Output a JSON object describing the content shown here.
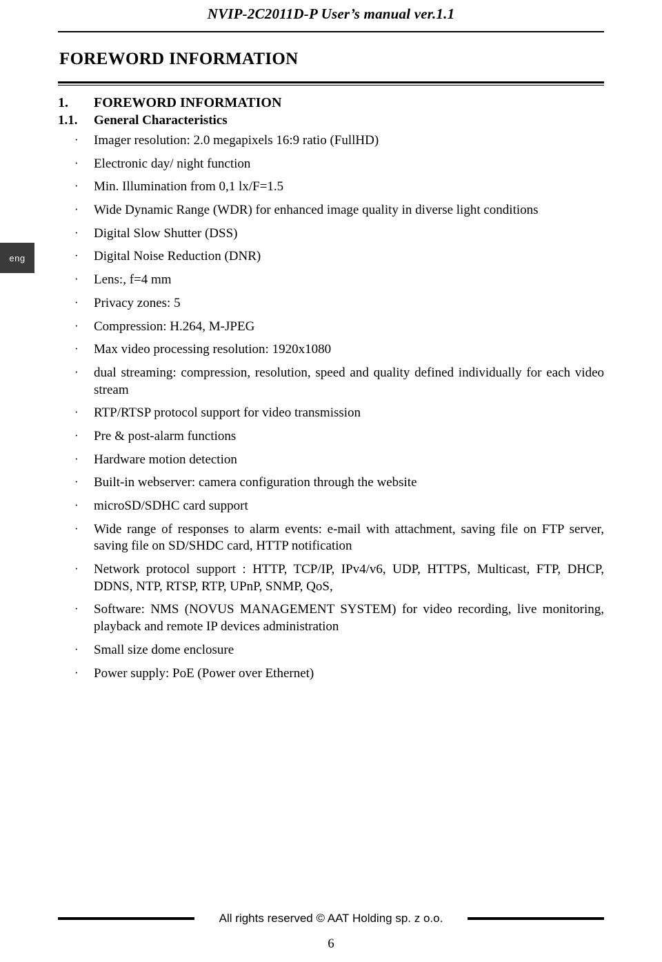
{
  "header": {
    "title": "NVIP-2C2011D-P User’s manual ver.1.1"
  },
  "side_tab": {
    "label": "eng"
  },
  "section": {
    "title": "FOREWORD INFORMATION"
  },
  "headings": {
    "h1_number": "1.",
    "h1_text": "FOREWORD INFORMATION",
    "h2_number": "1.1.",
    "h2_text": "General Characteristics"
  },
  "bullets": [
    "Imager resolution: 2.0 megapixels 16:9 ratio (FullHD)",
    "Electronic day/ night function",
    "Min. Illumination from 0,1 lx/F=1.5",
    "Wide Dynamic Range (WDR) for enhanced image quality in diverse light conditions",
    "Digital Slow Shutter (DSS)",
    "Digital Noise Reduction (DNR)",
    "Lens:, f=4 mm",
    "Privacy zones: 5",
    "Compression: H.264, M-JPEG",
    "Max video processing resolution: 1920x1080",
    "dual streaming: compression, resolution, speed and quality defined individually for each video stream",
    "RTP/RTSP protocol support for video transmission",
    "Pre & post-alarm functions",
    "Hardware motion detection",
    "Built-in webserver: camera configuration through the website",
    "microSD/SDHC card support",
    "Wide range of responses to alarm events: e-mail with attachment, saving file on FTP server, saving file on SD/SHDC card, HTTP notification",
    "Network protocol support : HTTP, TCP/IP, IPv4/v6, UDP, HTTPS,  Multicast, FTP, DHCP, DDNS, NTP, RTSP, RTP, UPnP, SNMP, QoS,",
    "Software: NMS (NOVUS MANAGEMENT SYSTEM) for video recording, live monitoring, playback and remote IP devices administration",
    "Small size dome enclosure",
    "Power supply: PoE (Power over Ethernet)"
  ],
  "bullet_mark": "·",
  "footer": {
    "text": "All rights reserved © AAT Holding sp. z o.o.",
    "page_number": "6"
  }
}
